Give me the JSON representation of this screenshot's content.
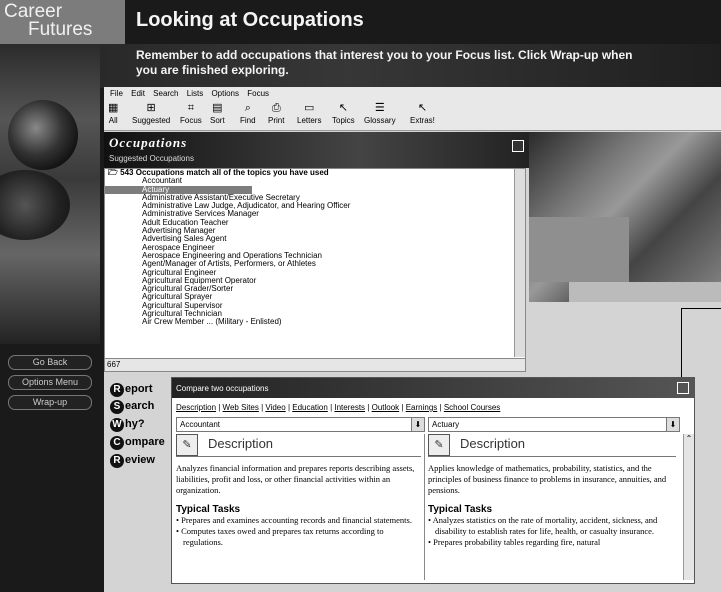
{
  "brand": {
    "line1": "Career",
    "line2": "Futures"
  },
  "header": {
    "title": "Looking at Occupations",
    "subtitle": "Remember to add occupations that interest you to your Focus list. Click Wrap-up when you are finished exploring."
  },
  "nav": {
    "go_back": "Go Back",
    "options_menu": "Options Menu",
    "wrap_up": "Wrap-up"
  },
  "menu": [
    "File",
    "Edit",
    "Search",
    "Lists",
    "Options",
    "Focus"
  ],
  "toolbar": [
    {
      "label": "All",
      "icon": "grid-icon"
    },
    {
      "label": "Suggested",
      "icon": "suggested-icon"
    },
    {
      "label": "Focus",
      "icon": "focus-icon"
    },
    {
      "label": "Sort",
      "icon": "sort-icon"
    },
    {
      "label": "Find",
      "icon": "magnifier-icon"
    },
    {
      "label": "Print",
      "icon": "printer-icon"
    },
    {
      "label": "Letters",
      "icon": "letters-icon"
    },
    {
      "label": "Topics",
      "icon": "topics-icon"
    },
    {
      "label": "Glossary",
      "icon": "glossary-icon"
    },
    {
      "label": "Extras!",
      "icon": "extras-icon"
    }
  ],
  "occupations": {
    "title": "Occupations",
    "subtitle": "Suggested Occupations",
    "header": "543 Occupations match all of the topics you have used",
    "count": "667",
    "selected_index": 1,
    "items": [
      "Accountant",
      "Actuary",
      "Administrative Assistant/Executive Secretary",
      "Administrative Law Judge, Adjudicator, and Hearing Officer",
      "Administrative Services Manager",
      "Adult Education Teacher",
      "Advertising Manager",
      "Advertising Sales Agent",
      "Aerospace Engineer",
      "Aerospace Engineering and Operations Technician",
      "Agent/Manager of Artists, Performers, or Athletes",
      "Agricultural Engineer",
      "Agricultural Equipment Operator",
      "Agricultural Grader/Sorter",
      "Agricultural Sprayer",
      "Agricultural Supervisor",
      "Agricultural Technician",
      "Air Crew Member ... (Military - Enlisted)"
    ]
  },
  "options": [
    {
      "letter": "R",
      "rest": "eport"
    },
    {
      "letter": "S",
      "rest": "earch"
    },
    {
      "letter": "W",
      "rest": "hy?"
    },
    {
      "letter": "C",
      "rest": "ompare"
    },
    {
      "letter": "R",
      "rest": "eview"
    }
  ],
  "compare": {
    "title": "Compare two occupations",
    "tabs": [
      "Description",
      "Web Sites",
      "Video",
      "Education",
      "Interests",
      "Outlook",
      "Earnings",
      "School Courses"
    ],
    "left": {
      "selected": "Accountant",
      "heading": "Description",
      "description": "Analyzes financial information and prepares reports describing assets, liabilities, profit and loss, or other financial activities within an organization.",
      "tasks_title": "Typical Tasks",
      "tasks": [
        "Prepares and examines accounting records and financial statements.",
        "Computes taxes owed and prepares tax returns according to regulations."
      ]
    },
    "right": {
      "selected": "Actuary",
      "heading": "Description",
      "description": "Applies knowledge of mathematics, probability, statistics, and the principles of business finance to problems in insurance, annuities, and pensions.",
      "tasks_title": "Typical Tasks",
      "tasks": [
        "Analyzes statistics on the rate of mortality, accident, sickness, and disability to establish rates for life, health, or casualty insurance.",
        "Prepares probability tables regarding fire, natural"
      ]
    }
  }
}
